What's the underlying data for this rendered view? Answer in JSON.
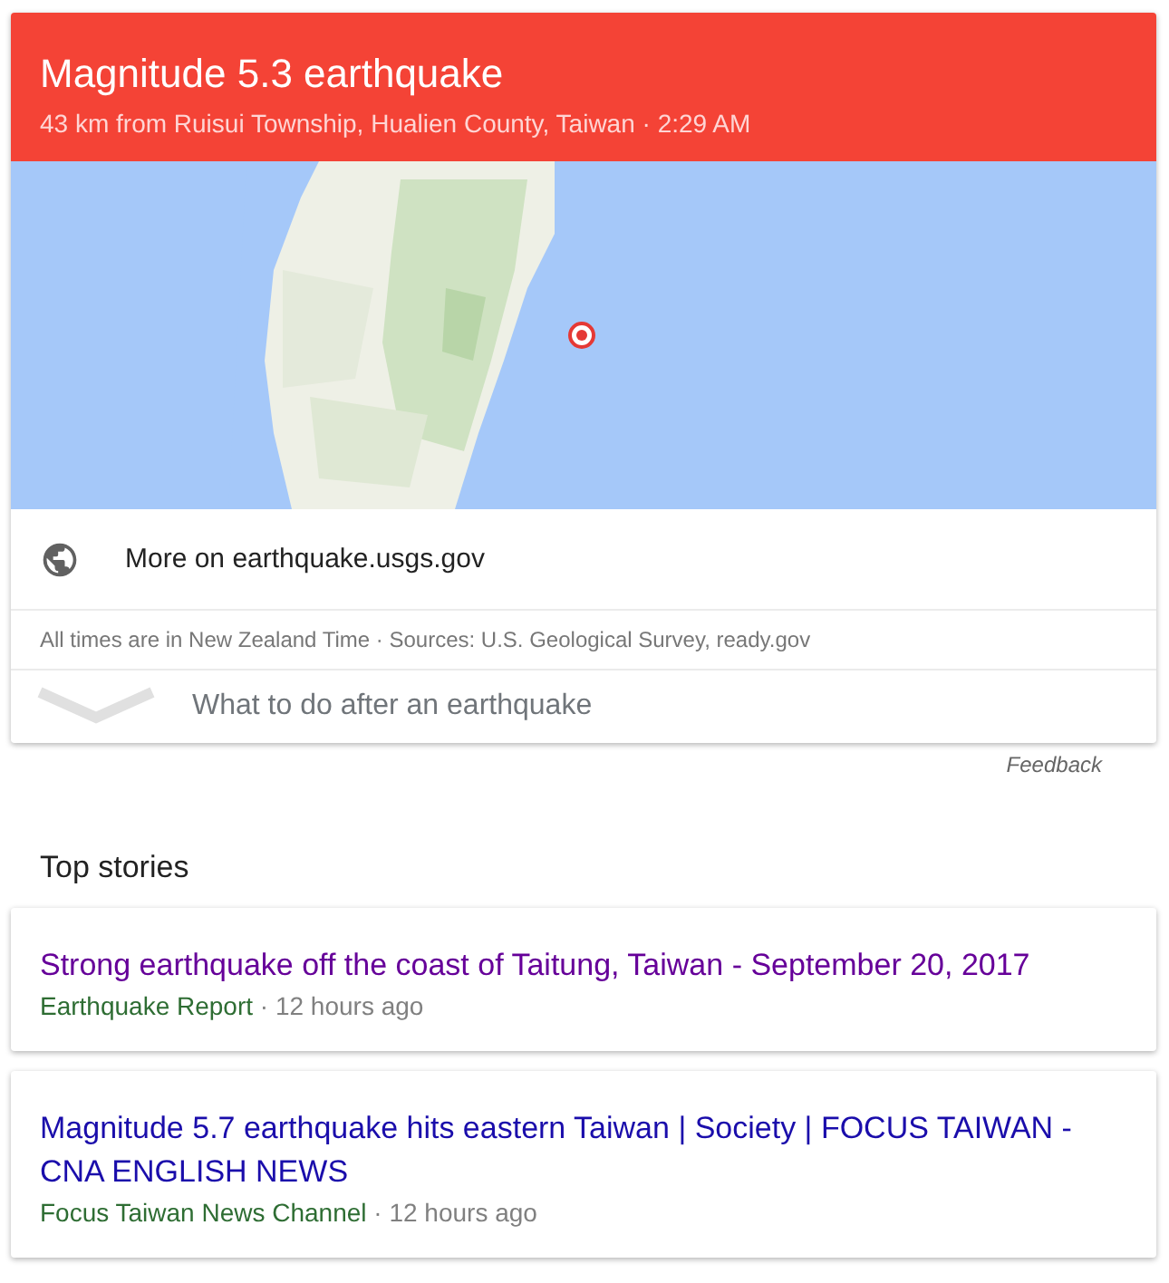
{
  "header": {
    "title": "Magnitude 5.3 earthquake",
    "subtitle": "43 km from Ruisui Township, Hualien County, Taiwan · 2:29 AM"
  },
  "source_link": "More on earthquake.usgs.gov",
  "note": "All times are in New Zealand Time · Sources: U.S. Geological Survey, ready.gov",
  "guide": {
    "label": "What to do after an earthquake",
    "expanded": false
  },
  "feedback": "Feedback",
  "top_stories": {
    "heading": "Top stories",
    "stories": [
      {
        "title": "Strong earthquake off the coast of Taitung, Taiwan - September 20, 2017",
        "visited": true,
        "source": "Earthquake Report",
        "separator": "·",
        "time": "12 hours ago"
      },
      {
        "title": "Magnitude 5.7 earthquake hits eastern Taiwan | Society | FOCUS TAIWAN - CNA ENGLISH NEWS",
        "visited": false,
        "source": "Focus Taiwan News Channel",
        "separator": "·",
        "time": "12 hours ago"
      }
    ]
  }
}
